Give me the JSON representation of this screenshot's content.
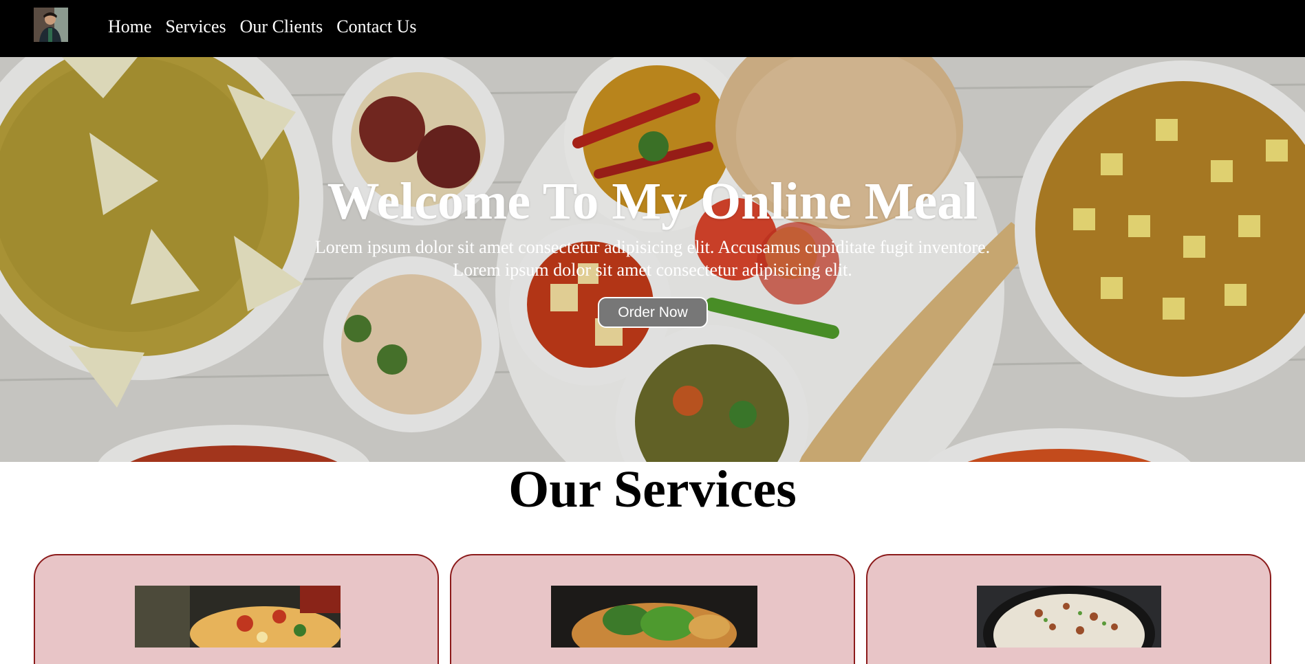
{
  "nav": {
    "logo_icon": "profile-photo-icon",
    "links": [
      {
        "label": "Home"
      },
      {
        "label": "Services"
      },
      {
        "label": "Our Clients"
      },
      {
        "label": "Contact Us"
      }
    ]
  },
  "hero": {
    "title": "Welcome To My Online Meal",
    "line1": "Lorem ipsum dolor sit amet consectetur adipisicing elit. Accusamus cupiditate fugit inventore.",
    "line2": "Lorem ipsum dolor sit amet consectetur adipisicing elit.",
    "button_label": "Order Now"
  },
  "services": {
    "title": "Our Services",
    "cards": [
      {
        "image_icon": "pizza-image-icon"
      },
      {
        "image_icon": "burger-image-icon"
      },
      {
        "image_icon": "biryani-image-icon"
      }
    ]
  },
  "colors": {
    "navbar": "#000000",
    "card_bg": "#e8c5c7",
    "card_border": "#8b1a1a",
    "button_bg": "#777777"
  }
}
